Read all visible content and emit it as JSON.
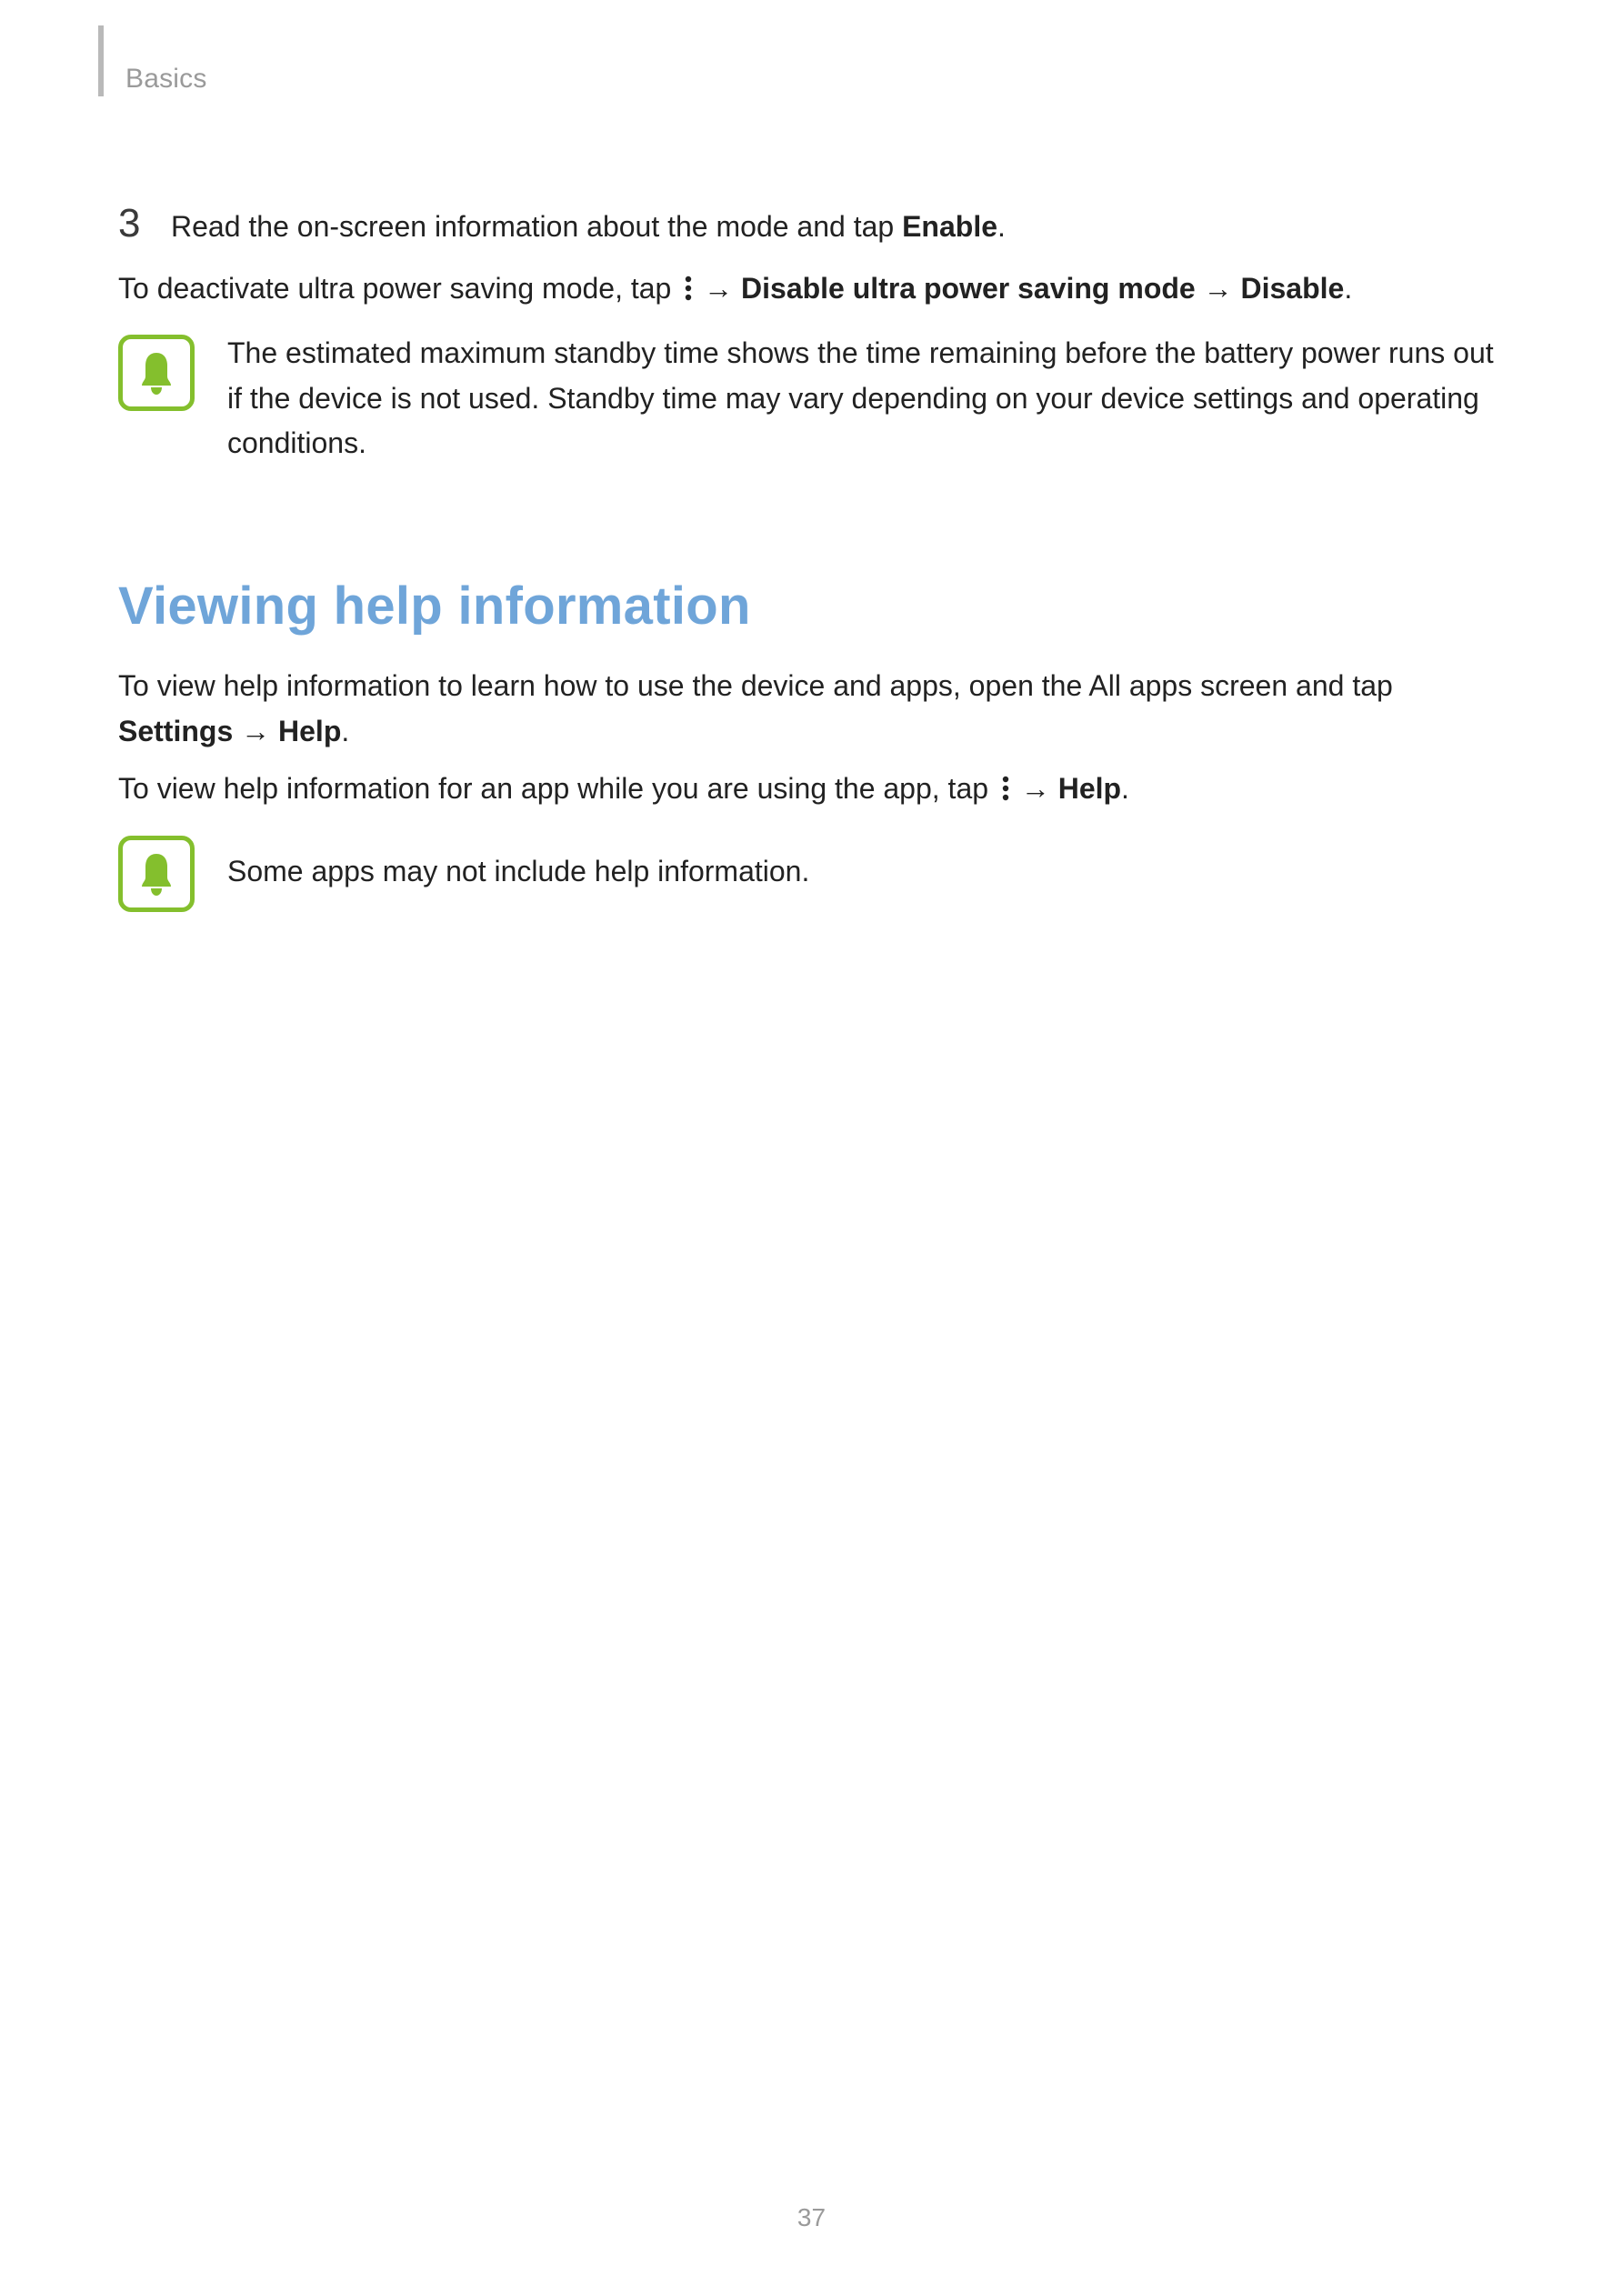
{
  "header": {
    "chapter": "Basics"
  },
  "step3": {
    "number": "3",
    "prefix": "Read the on-screen information about the mode and tap ",
    "bold": "Enable",
    "suffix": "."
  },
  "deactivate": {
    "prefix": "To deactivate ultra power saving mode, tap ",
    "arrow1": " → ",
    "bold1": "Disable ultra power saving mode",
    "arrow2": " → ",
    "bold2": "Disable",
    "suffix": "."
  },
  "note1": "The estimated maximum standby time shows the time remaining before the battery power runs out if the device is not used. Standby time may vary depending on your device settings and operating conditions.",
  "section_title": "Viewing help information",
  "help_para1": {
    "prefix": "To view help information to learn how to use the device and apps, open the All apps screen and tap ",
    "bold1": "Settings",
    "arrow": " → ",
    "bold2": "Help",
    "suffix": "."
  },
  "help_para2": {
    "prefix": "To view help information for an app while you are using the app, tap ",
    "arrow": " → ",
    "bold": "Help",
    "suffix": "."
  },
  "note2": "Some apps may not include help information.",
  "page_number": "37"
}
